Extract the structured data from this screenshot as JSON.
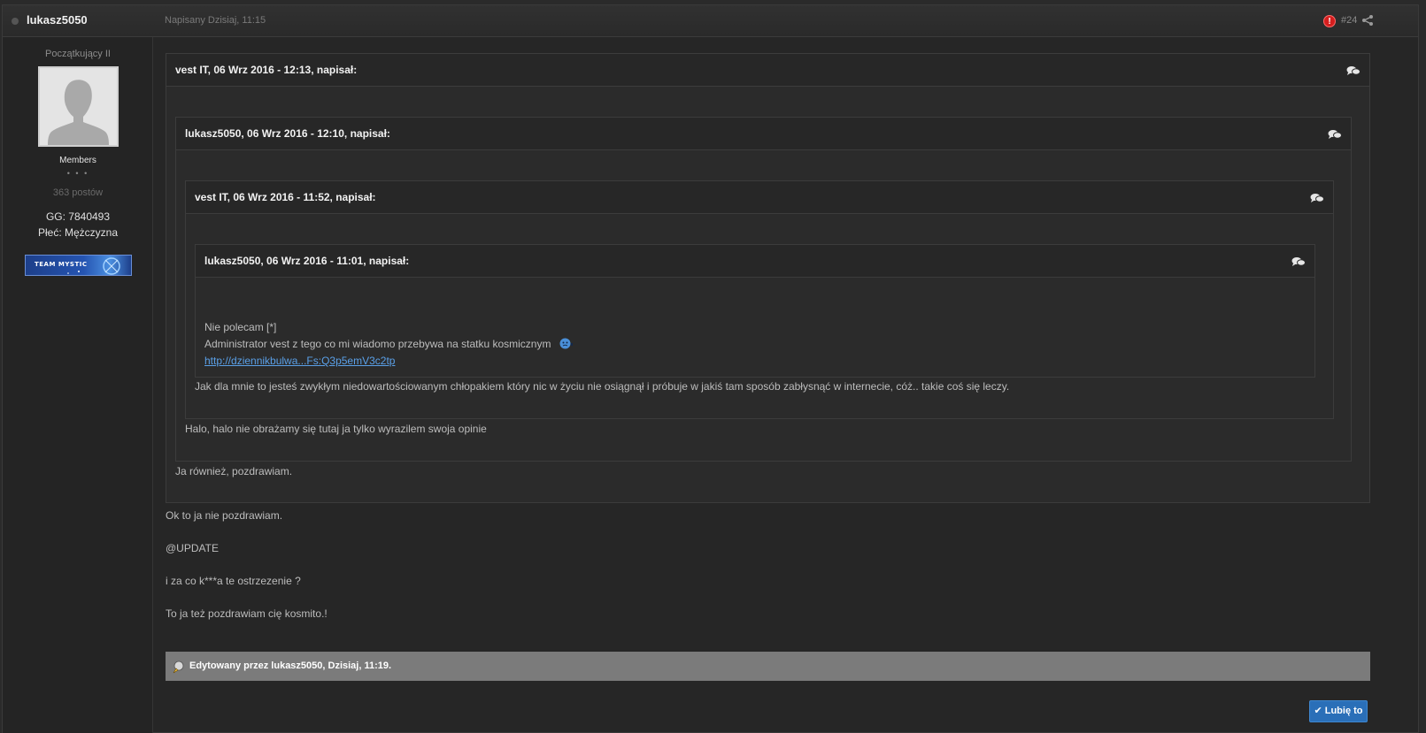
{
  "header": {
    "author": "lukasz5050",
    "date": "Napisany Dzisiaj, 11:15",
    "post_number": "#24",
    "report_glyph": "!"
  },
  "sidebar": {
    "rank": "Początkujący II",
    "group": "Members",
    "pips": "• • •",
    "posts": "363 postów",
    "gg": "GG: 7840493",
    "gender": "Płeć: Mężczyzna",
    "banner_text": "TEAM MYSTIC"
  },
  "quotes": {
    "q1": {
      "title": "vest IT, 06 Wrz 2016 - 12:13, napisał:"
    },
    "q2": {
      "title": "lukasz5050, 06 Wrz 2016 - 12:10, napisał:"
    },
    "q3": {
      "title": "vest IT, 06 Wrz 2016 - 11:52, napisał:"
    },
    "q4": {
      "title": "lukasz5050, 06 Wrz 2016 - 11:01, napisał:",
      "line1": "Nie polecam [*]",
      "line2": "Administrator vest z tego co mi wiadomo przebywa na statku kosmicznym",
      "link": "http://dziennikbulwa...Fs:Q3p5emV3c2tp"
    },
    "q3_reply": "Jak dla mnie to jesteś zwykłym niedowartościowanym chłopakiem który nic w życiu nie osiągnął i próbuje w jakiś tam sposób zabłysnąć w internecie, cóż.. takie coś się leczy.",
    "q2_reply": "Halo, halo nie obrażamy się tutaj ja tylko wyrazilem swoja opinie",
    "q1_reply": "Ja również, pozdrawiam."
  },
  "body": {
    "line1": "Ok to ja nie pozdrawiam.",
    "line2": "@UPDATE",
    "line3": "i za co k***a te ostrzezenie ?",
    "line4": "To ja też pozdrawiam cię kosmito.!"
  },
  "edit_note": "Edytowany przez lukasz5050, Dzisiaj, 11:19.",
  "like_button": "✔ Lubię to",
  "colors": {
    "background": "#2a2a2a",
    "link": "#5aa0e8",
    "like_button": "#2a6fb8",
    "report": "#d41e1e",
    "edit_bar": "#7b7b7b"
  },
  "icons": [
    "report-icon",
    "share-icon",
    "quote-bubbles-icon",
    "emoticon-icon",
    "edit-pencil-icon",
    "avatar-placeholder-icon"
  ]
}
